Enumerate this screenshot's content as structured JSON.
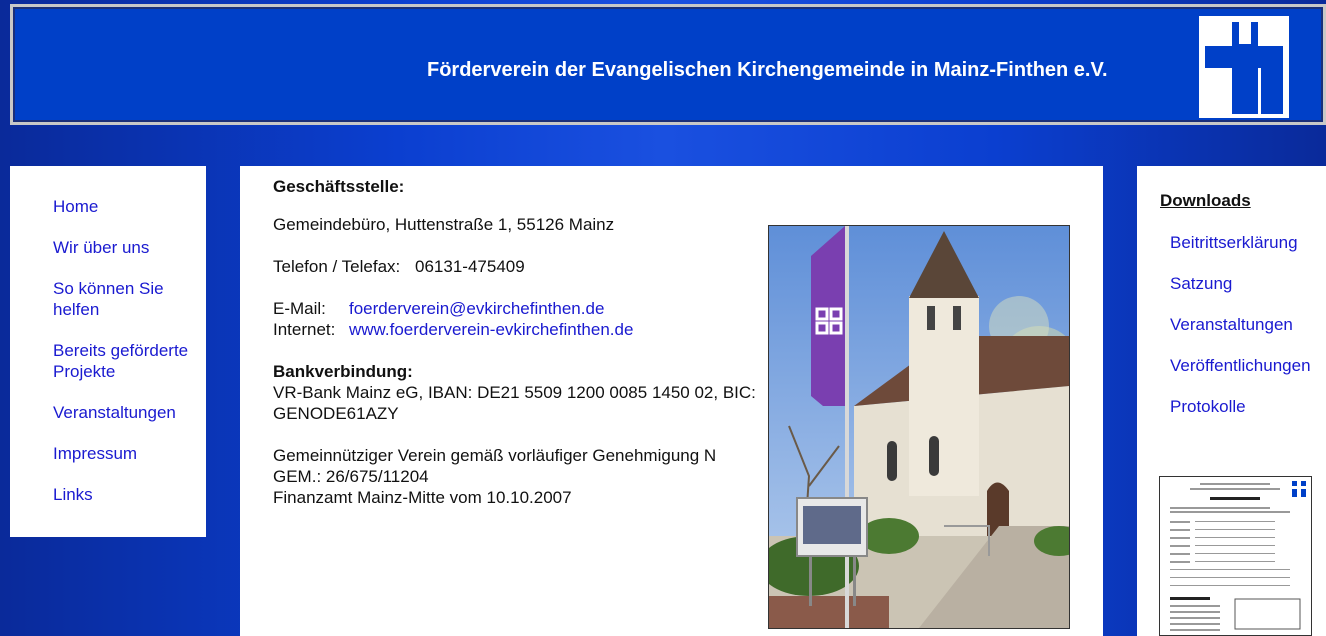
{
  "header": {
    "title": "Förderverein der Evangelischen Kirchengemeinde in Mainz-Finthen e.V."
  },
  "left_nav": {
    "items": [
      {
        "label": "Home"
      },
      {
        "label": "Wir über uns"
      },
      {
        "label": "So können Sie helfen"
      },
      {
        "label": "Bereits geförderte Projekte"
      },
      {
        "label": "Veranstaltungen"
      },
      {
        "label": "Impressum"
      },
      {
        "label": "Links"
      }
    ]
  },
  "main": {
    "heading": "Geschäftsstelle:",
    "address": "Gemeindebüro, Huttenstraße 1, 55126 Mainz",
    "phone_label": "Telefon / Telefax:",
    "phone": "06131-475409",
    "email_label": "E-Mail:",
    "email": "foerderverein@evkirchefinthen.de",
    "internet_label": "Internet:",
    "internet": "www.foerderverein-evkirchefinthen.de",
    "bank_heading": "Bankverbindung:",
    "bank_line1": "VR-Bank Mainz eG, IBAN: DE21 5509 1200 0085 1450 02, BIC:",
    "bank_line2": "GENODE61AZY",
    "note_line1": "Gemeinnütziger Verein gemäß vorläufiger Genehmigung N",
    "note_line2": "GEM.: 26/675/11204",
    "note_line3": "Finanzamt Mainz-Mitte vom 10.10.2007"
  },
  "right_nav": {
    "heading": "Downloads",
    "items": [
      {
        "label": "Beitrittserklärung"
      },
      {
        "label": "Satzung"
      },
      {
        "label": "Veranstaltungen"
      },
      {
        "label": "Veröffentlichungen"
      },
      {
        "label": "Protokolle"
      }
    ]
  },
  "thumbnail": {
    "org": "Förderverein der Evangelischen Kirchengemeinde in Mainz-Finthen e.V.",
    "title": "Beitrittserklärung"
  },
  "colors": {
    "link": "#1a1ad0",
    "header_bg": "#0040c8",
    "flag": "#7a3fb0"
  },
  "icons": {
    "logo": "cross-logo-icon",
    "photo": "church-photo"
  }
}
